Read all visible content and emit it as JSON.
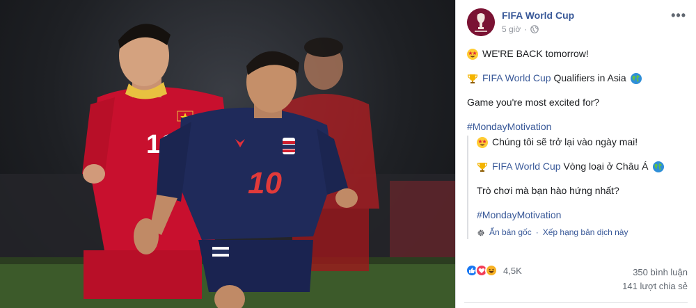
{
  "header": {
    "page_name": "FIFA World Cup",
    "time": "5 giờ",
    "separator": "·",
    "more_label": "•••"
  },
  "post": {
    "line1_text": "WE'RE BACK tomorrow!",
    "line2_link": "FIFA World Cup",
    "line2_text": "Qualifiers in Asia",
    "line3_text": "Game you're most excited for?",
    "hashtag": "#MondayMotivation"
  },
  "translation": {
    "line1_text": "Chúng tôi sẽ trở lại vào ngày mai!",
    "line2_link": "FIFA World Cup",
    "line2_text": "Vòng loại ở Châu Á",
    "line3_text": "Trò chơi mà bạn hào hứng nhất?",
    "hashtag": "#MondayMotivation",
    "hide_original": "Ẩn bản gốc",
    "dot": "·",
    "rate_translation": "Xếp hạng bản dịch này"
  },
  "engagement": {
    "reaction_count": "4,5K",
    "comments": "350 bình luận",
    "shares": "141 lượt chia sẻ"
  },
  "photo": {
    "player_left_number": "16",
    "player_center_number": "10"
  },
  "colors": {
    "link": "#385898",
    "meta": "#90949c",
    "vietnam_red": "#c8102e",
    "thailand_navy": "#1f2a5a",
    "like_blue": "#1877f2",
    "love_red": "#f33e58",
    "haha_yellow": "#f7b125"
  },
  "icons": [
    "globe-icon",
    "star-eyes-emoji",
    "trophy-emoji",
    "earth-emoji",
    "gear-icon",
    "like-reaction-icon",
    "love-reaction-icon",
    "haha-reaction-icon",
    "more-options-icon"
  ]
}
